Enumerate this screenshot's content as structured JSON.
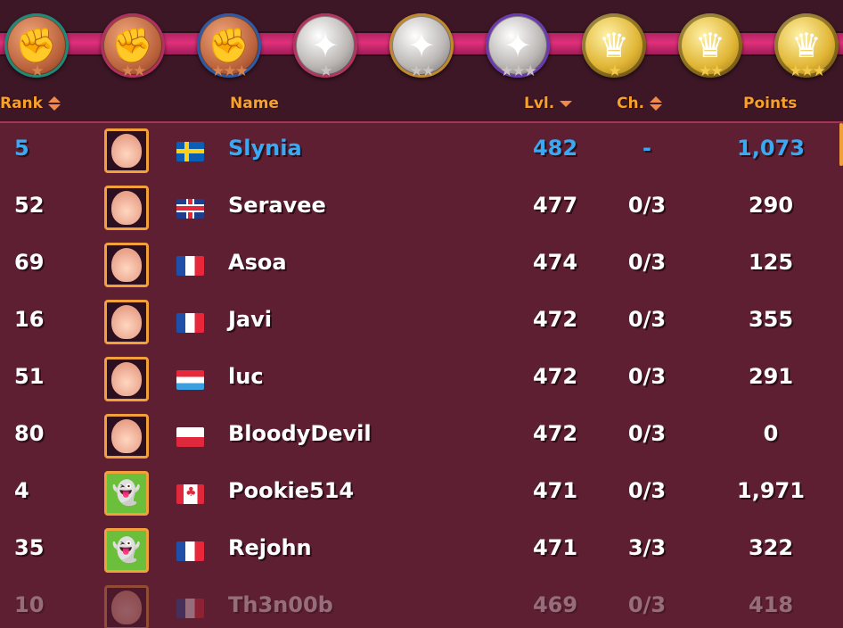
{
  "league": {
    "tiers": [
      {
        "name": "wanker-1-icon",
        "metal": "bronze",
        "ring": "c1",
        "glyph": "✊",
        "stars": "★"
      },
      {
        "name": "wanker-2-icon",
        "metal": "bronze",
        "ring": "c2",
        "glyph": "✊",
        "stars": "★★"
      },
      {
        "name": "wanker-3-icon",
        "metal": "bronze",
        "ring": "c3",
        "glyph": "✊",
        "stars": "★★★"
      },
      {
        "name": "sexpert-1-icon",
        "metal": "silver",
        "ring": "c4",
        "glyph": "✦",
        "stars": "★"
      },
      {
        "name": "sexpert-2-icon",
        "metal": "silver",
        "ring": "c5",
        "glyph": "✦",
        "stars": "★★"
      },
      {
        "name": "sexpert-3-icon",
        "metal": "silver",
        "ring": "c6",
        "glyph": "✦",
        "stars": "★★★"
      },
      {
        "name": "dicktator-1-icon",
        "metal": "gold",
        "ring": "",
        "glyph": "♛",
        "stars": "★"
      },
      {
        "name": "dicktator-2-icon",
        "metal": "gold",
        "ring": "",
        "glyph": "♛",
        "stars": "★★"
      },
      {
        "name": "dicktator-3-icon",
        "metal": "gold",
        "ring": "",
        "glyph": "♛",
        "stars": "★★★"
      }
    ]
  },
  "table": {
    "headers": {
      "rank": "Rank",
      "name": "Name",
      "lvl": "Lvl.",
      "ch": "Ch.",
      "points": "Points"
    },
    "rows": [
      {
        "rank": "5",
        "name": "Slynia",
        "flag": "se",
        "lvl": "482",
        "ch": "-",
        "points": "1,073",
        "self": true,
        "avatar": "girl"
      },
      {
        "rank": "52",
        "name": "Seravee",
        "flag": "gb",
        "lvl": "477",
        "ch": "0/3",
        "points": "290",
        "avatar": "girl"
      },
      {
        "rank": "69",
        "name": "Asoa",
        "flag": "fr",
        "lvl": "474",
        "ch": "0/3",
        "points": "125",
        "avatar": "girl"
      },
      {
        "rank": "16",
        "name": "Javi",
        "flag": "fr",
        "lvl": "472",
        "ch": "0/3",
        "points": "355",
        "avatar": "girl"
      },
      {
        "rank": "51",
        "name": "luc",
        "flag": "lu",
        "lvl": "472",
        "ch": "0/3",
        "points": "291",
        "avatar": "girl"
      },
      {
        "rank": "80",
        "name": "BloodyDevil",
        "flag": "pl",
        "lvl": "472",
        "ch": "0/3",
        "points": "0",
        "avatar": "girl"
      },
      {
        "rank": "4",
        "name": "Pookie514",
        "flag": "ca",
        "lvl": "471",
        "ch": "0/3",
        "points": "1,971",
        "avatar": "ghost"
      },
      {
        "rank": "35",
        "name": "Rejohn",
        "flag": "fr",
        "lvl": "471",
        "ch": "3/3",
        "points": "322",
        "avatar": "ghost"
      },
      {
        "rank": "10",
        "name": "Th3n00b",
        "flag": "fr",
        "lvl": "469",
        "ch": "0/3",
        "points": "418",
        "avatar": "girl",
        "faded": true
      }
    ]
  },
  "colors": {
    "background": "#5e1f33",
    "header_text": "#f7a02c",
    "self_text": "#3aa9f4",
    "accent_border": "#f2a13a"
  }
}
